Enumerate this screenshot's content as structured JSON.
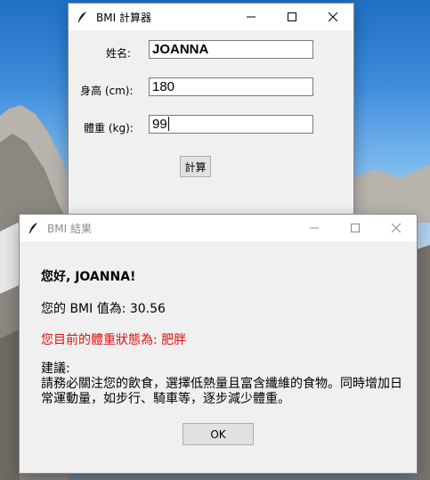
{
  "colors": {
    "warning_text": "#dd1111",
    "window_bg": "#f0f0f0",
    "titlebar_bg": "#ffffff"
  },
  "bmi_calculator_window": {
    "title": "BMI 計算器",
    "icon": "feather-icon",
    "name_label": "姓名:",
    "name_value": "JOANNA",
    "height_label": "身高 (cm):",
    "height_value": "180",
    "weight_label": "體重 (kg):",
    "weight_value": "99",
    "calculate_button": "計算"
  },
  "bmi_result_window": {
    "title": "BMI 結果",
    "icon": "feather-icon",
    "greeting": "您好, JOANNA!",
    "bmi_line": "您的 BMI 值為: 30.56",
    "status_line": "您目前的體重狀態為: 肥胖",
    "advice_heading": "建議:",
    "advice_text": "請務必關注您的飲食，選擇低熱量且富含纖維的食物。同時增加日常運動量，如步行、騎車等，逐步減少體重。",
    "ok_button": "OK"
  }
}
